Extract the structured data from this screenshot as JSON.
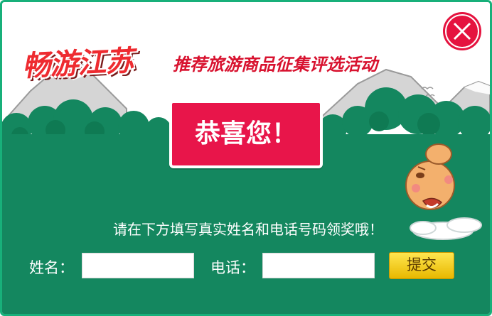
{
  "dialog": {
    "brand_title": "畅游江苏",
    "event_title": "推荐旅游商品征集评选活动",
    "congrats": "恭喜您！",
    "instruction": "请在下方填写真实姓名和电话号码领奖哦！",
    "close_icon": "close-icon"
  },
  "form": {
    "name_label": "姓名：",
    "name_value": "",
    "name_placeholder": "",
    "phone_label": "电话：",
    "phone_value": "",
    "phone_placeholder": "",
    "submit_label": "提交"
  },
  "colors": {
    "accent_green": "#14875f",
    "frame_green": "#18b07a",
    "congrats_red": "#e8154a",
    "close_red": "#e5133f",
    "button_yellow": "#f5cf1e"
  }
}
